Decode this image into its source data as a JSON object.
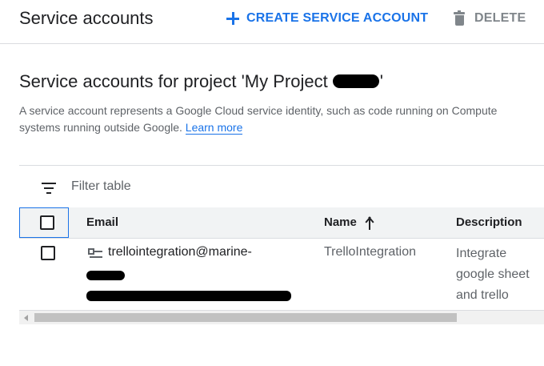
{
  "header": {
    "title": "Service accounts",
    "create_label": "CREATE SERVICE ACCOUNT",
    "delete_label": "DELETE"
  },
  "section": {
    "title_prefix": "Service accounts for project 'My Project",
    "title_suffix": "'",
    "description_line1": "A service account represents a Google Cloud service identity, such as code running on Compute",
    "description_line2": "systems running outside Google.",
    "learn_more": "Learn more"
  },
  "table": {
    "filter_placeholder": "Filter table",
    "columns": {
      "email": "Email",
      "name": "Name",
      "description": "Description"
    },
    "sorted_column": "Name",
    "sort_direction": "ascending",
    "rows": [
      {
        "email": "trellointegration@marine-",
        "name": "TrelloIntegration",
        "description": [
          "Integrate",
          "google sheet",
          "and trello"
        ]
      }
    ]
  },
  "icons": {
    "create": "plus-icon",
    "delete": "trash-icon",
    "filter": "filter-icon",
    "sort": "arrow-up-icon",
    "service_account": "service-account-key-icon"
  },
  "colors": {
    "accent": "#1a73e8",
    "disabled": "#80868b",
    "header_bg": "#f1f3f4"
  }
}
